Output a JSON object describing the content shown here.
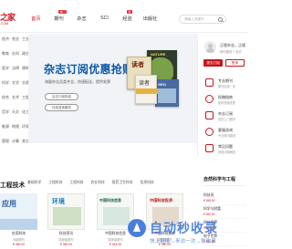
{
  "header": {
    "logo_zh": "之家",
    "logo_en": ".COM",
    "nav": [
      {
        "label": "首页",
        "badge": ""
      },
      {
        "label": "期刊",
        "badge": "热门"
      },
      {
        "label": "杂志",
        "badge": ""
      },
      {
        "label": "SCI",
        "badge": ""
      },
      {
        "label": "经验",
        "badge": "新"
      },
      {
        "label": "出版社",
        "badge": ""
      }
    ],
    "search_placeholder": "请输入关键字"
  },
  "sidebar": {
    "rows": [
      [
        "经济",
        "农业",
        "工业"
      ],
      [
        "教育",
        "社科",
        "政治"
      ],
      [
        "医学",
        "法律",
        "建筑"
      ],
      [
        "科学",
        "文学",
        "交通"
      ],
      [
        "综合",
        "艺术",
        "工程"
      ],
      [
        "哲学",
        "天文",
        "化工"
      ],
      [
        "能源",
        "地理",
        "环境"
      ],
      [
        "管理",
        "计算",
        "其它"
      ]
    ]
  },
  "banner": {
    "title": "杂志订阅优惠抢购",
    "subtitle": "海量杂志品类齐全，快速配送，提供发票",
    "btn1": "杂志订阅热线",
    "btn2": "在线咨询服务",
    "mag_a": "读者",
    "mag_b": "NATURE",
    "mag_c": "读者",
    "mag_d": "GEO"
  },
  "right_panel": {
    "greeting": "正版杂志，正规",
    "sub": "期刊服务一站式",
    "login": "提交订阅",
    "register": "登录",
    "items": [
      {
        "label": "专业期刊",
        "desc": "期刊目录一览"
      },
      {
        "label": "投稿指南",
        "desc": "如何快速发表"
      },
      {
        "label": "杂志订阅",
        "desc": "送货上门服务"
      },
      {
        "label": "客服咨询",
        "desc": "专业顾问服务"
      },
      {
        "label": "常见问题",
        "desc": "常用问题解答"
      }
    ]
  },
  "section": {
    "title": "工程技术",
    "tabs": [
      "基础科学",
      "工程科技",
      "工程科技",
      "农业科技",
      "医药卫生科技",
      "信息科技"
    ],
    "right_title": "自然科学与工程"
  },
  "cards": [
    {
      "cover": "应用",
      "name": "应用科技",
      "tag": "省级期刊",
      "price": "¥ 480.00"
    },
    {
      "cover": "环境",
      "name": "科技资讯",
      "tag": "国家级期刊",
      "price": "¥ 360.00"
    },
    {
      "cover": "中国科技信息",
      "name": "中国科技信息",
      "tag": "国家级期刊",
      "price": "¥ 444.00"
    },
    {
      "cover": "中国科技投资",
      "name": "中国科技投资",
      "tag": "国家级期刊",
      "price": "¥ 480.00"
    }
  ],
  "rp_list": [
    {
      "name": "科技风",
      "price": "¥ 268.00"
    },
    {
      "name": "科学与财富",
      "price": "¥ 360.00"
    },
    {
      "name": "科技视界",
      "price": "¥ 360.00"
    },
    {
      "name": "电子世界",
      "price": "¥ 240.00"
    }
  ],
  "watermark": {
    "title": "自动秒收录",
    "sub": "快上链接→来访一次→秒收录"
  },
  "colors": {
    "brand": "#c8161d",
    "banner_title": "#0c5aa6",
    "watermark": "#2b6bd6"
  }
}
